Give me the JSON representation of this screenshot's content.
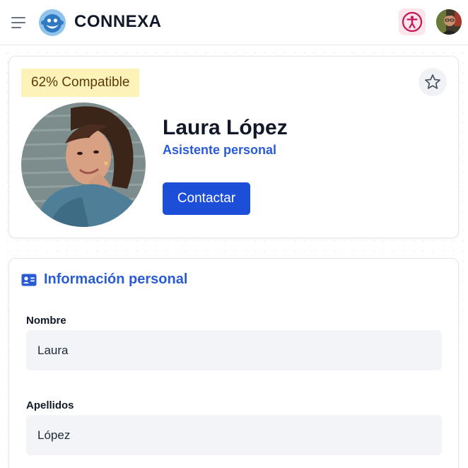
{
  "app": {
    "brand": "CONNEXA"
  },
  "header": {
    "menu_icon": "hamburger-icon",
    "accessibility_icon": "accessibility-icon",
    "accent": "#c2185b"
  },
  "profile": {
    "compatibility": "62% Compatible",
    "name": "Laura López",
    "role": "Asistente personal",
    "contact_label": "Contactar",
    "favorite_icon": "star-icon"
  },
  "personal_info": {
    "title": "Información personal",
    "section_icon": "id-card-icon",
    "fields": [
      {
        "label": "Nombre",
        "value": "Laura"
      },
      {
        "label": "Apellidos",
        "value": "López"
      }
    ]
  },
  "colors": {
    "primary": "#1d4ed8",
    "link": "#2a5bd7",
    "badge_bg": "#fdf2b8"
  }
}
